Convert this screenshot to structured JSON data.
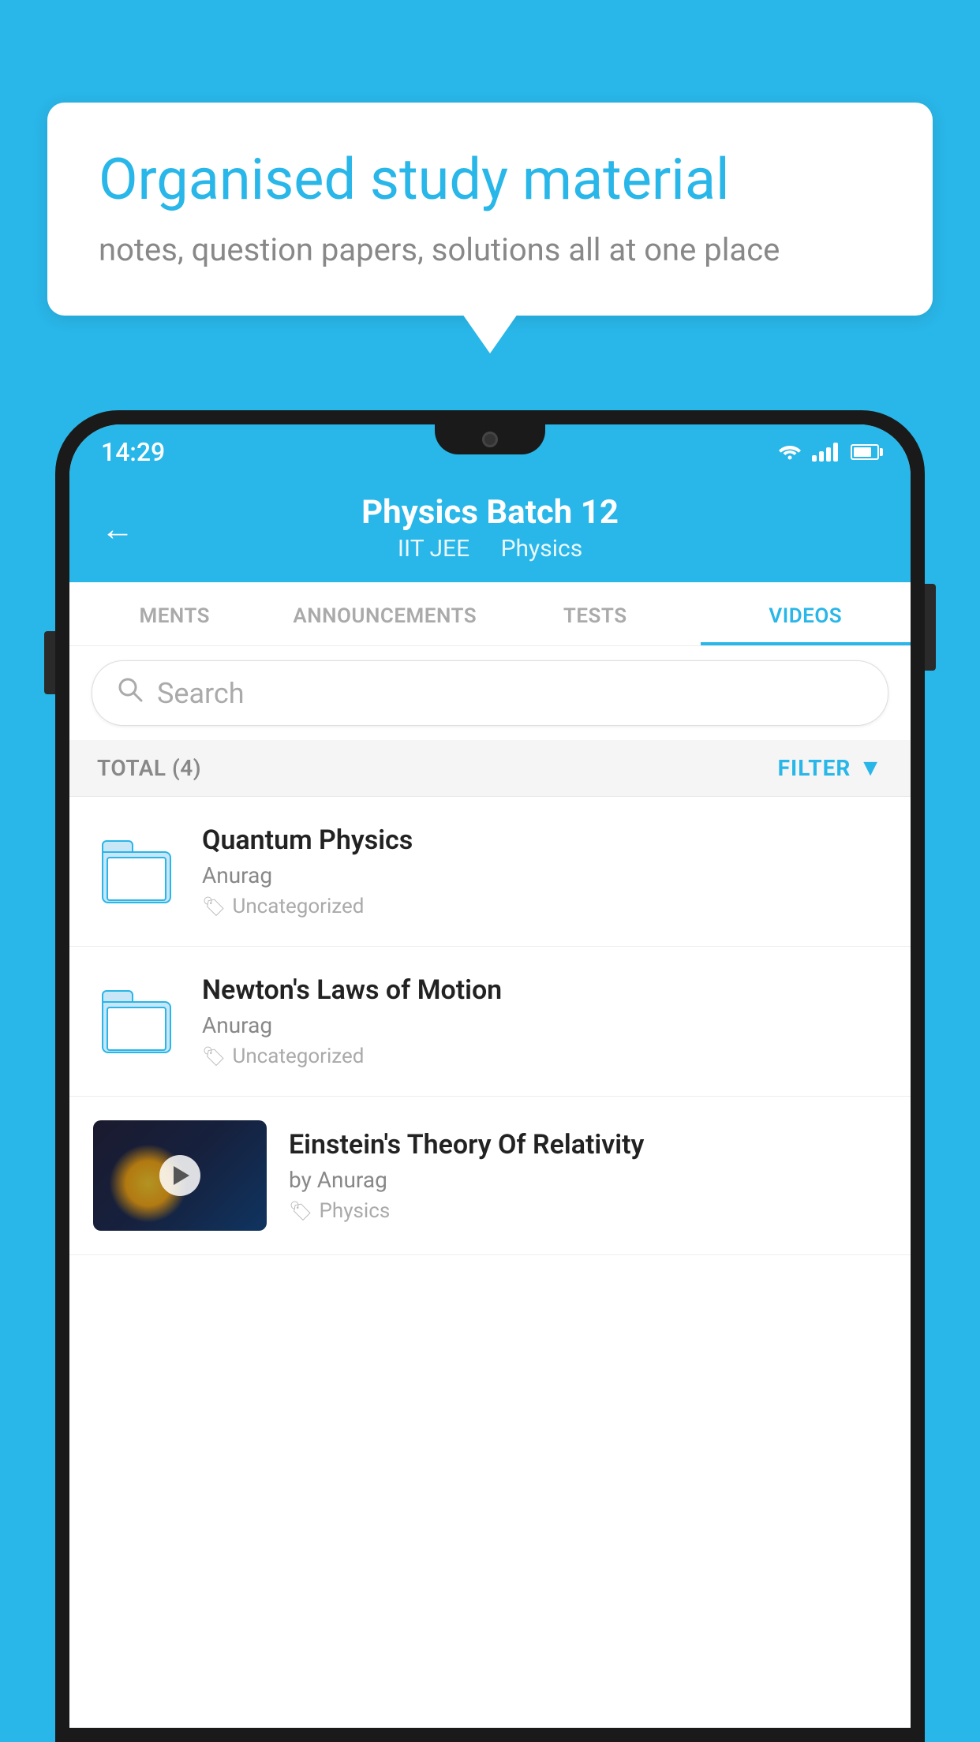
{
  "background_color": "#29b6e8",
  "bubble": {
    "title": "Organised study material",
    "subtitle": "notes, question papers, solutions all at one place"
  },
  "status_bar": {
    "time": "14:29"
  },
  "header": {
    "title": "Physics Batch 12",
    "subtitle_parts": [
      "IIT JEE",
      "Physics"
    ],
    "back_label": "←"
  },
  "tabs": [
    {
      "label": "MENTS",
      "active": false
    },
    {
      "label": "ANNOUNCEMENTS",
      "active": false
    },
    {
      "label": "TESTS",
      "active": false
    },
    {
      "label": "VIDEOS",
      "active": true
    }
  ],
  "search": {
    "placeholder": "Search"
  },
  "filter_bar": {
    "total_label": "TOTAL (4)",
    "filter_label": "FILTER"
  },
  "videos": [
    {
      "title": "Quantum Physics",
      "author": "Anurag",
      "tag": "Uncategorized",
      "type": "folder"
    },
    {
      "title": "Newton's Laws of Motion",
      "author": "Anurag",
      "tag": "Uncategorized",
      "type": "folder"
    },
    {
      "title": "Einstein's Theory Of Relativity",
      "author": "by Anurag",
      "tag": "Physics",
      "type": "video"
    }
  ]
}
